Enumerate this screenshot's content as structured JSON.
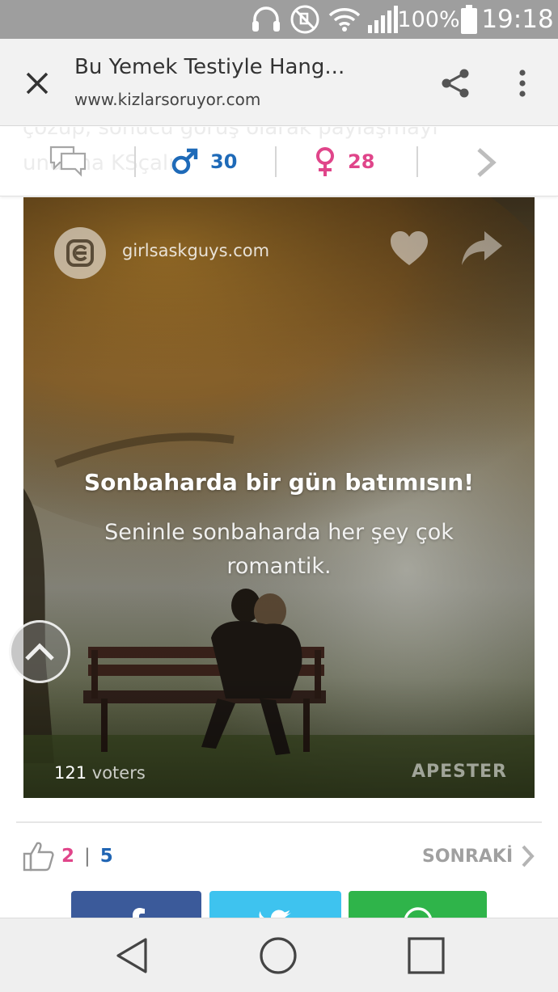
{
  "status_bar": {
    "battery": "100%",
    "time": "19:18",
    "icons": [
      "headphones-icon",
      "mute-icon",
      "wifi-icon",
      "signal-icon",
      "battery-icon"
    ]
  },
  "toolbar": {
    "title": "Bu Yemek Testiyle Hang...",
    "url": "www.kizlarsoruyor.com",
    "icons": [
      "close-icon",
      "share-icon",
      "more-vert-icon"
    ]
  },
  "stats": {
    "ghost_line_1": "çözüp, sonucu görüş olarak paylaşmayı",
    "ghost_line_2": "unutma KSçalı",
    "male_count": "30",
    "female_count": "28",
    "male_color": "#1e6ab8",
    "female_color": "#e0458a"
  },
  "quiz_card": {
    "site": "girlsaskguys.com",
    "title": "Sonbaharda bir gün batımısın!",
    "subtitle": "Seninle sonbaharda her şey çok romantik.",
    "voters_count": "121",
    "voters_label": "voters",
    "brand": "APESTER"
  },
  "actions": {
    "likes_pink": "2",
    "separator": "|",
    "likes_blue": "5",
    "next_label": "SONRAKİ"
  },
  "share_buttons": [
    {
      "network": "facebook",
      "color": "#3b5a9a"
    },
    {
      "network": "twitter",
      "color": "#3ec3ef"
    },
    {
      "network": "whatsapp",
      "color": "#2fb44a"
    }
  ],
  "nav_bar": {
    "icons": [
      "back-triangle-icon",
      "home-circle-icon",
      "recents-square-icon"
    ]
  }
}
